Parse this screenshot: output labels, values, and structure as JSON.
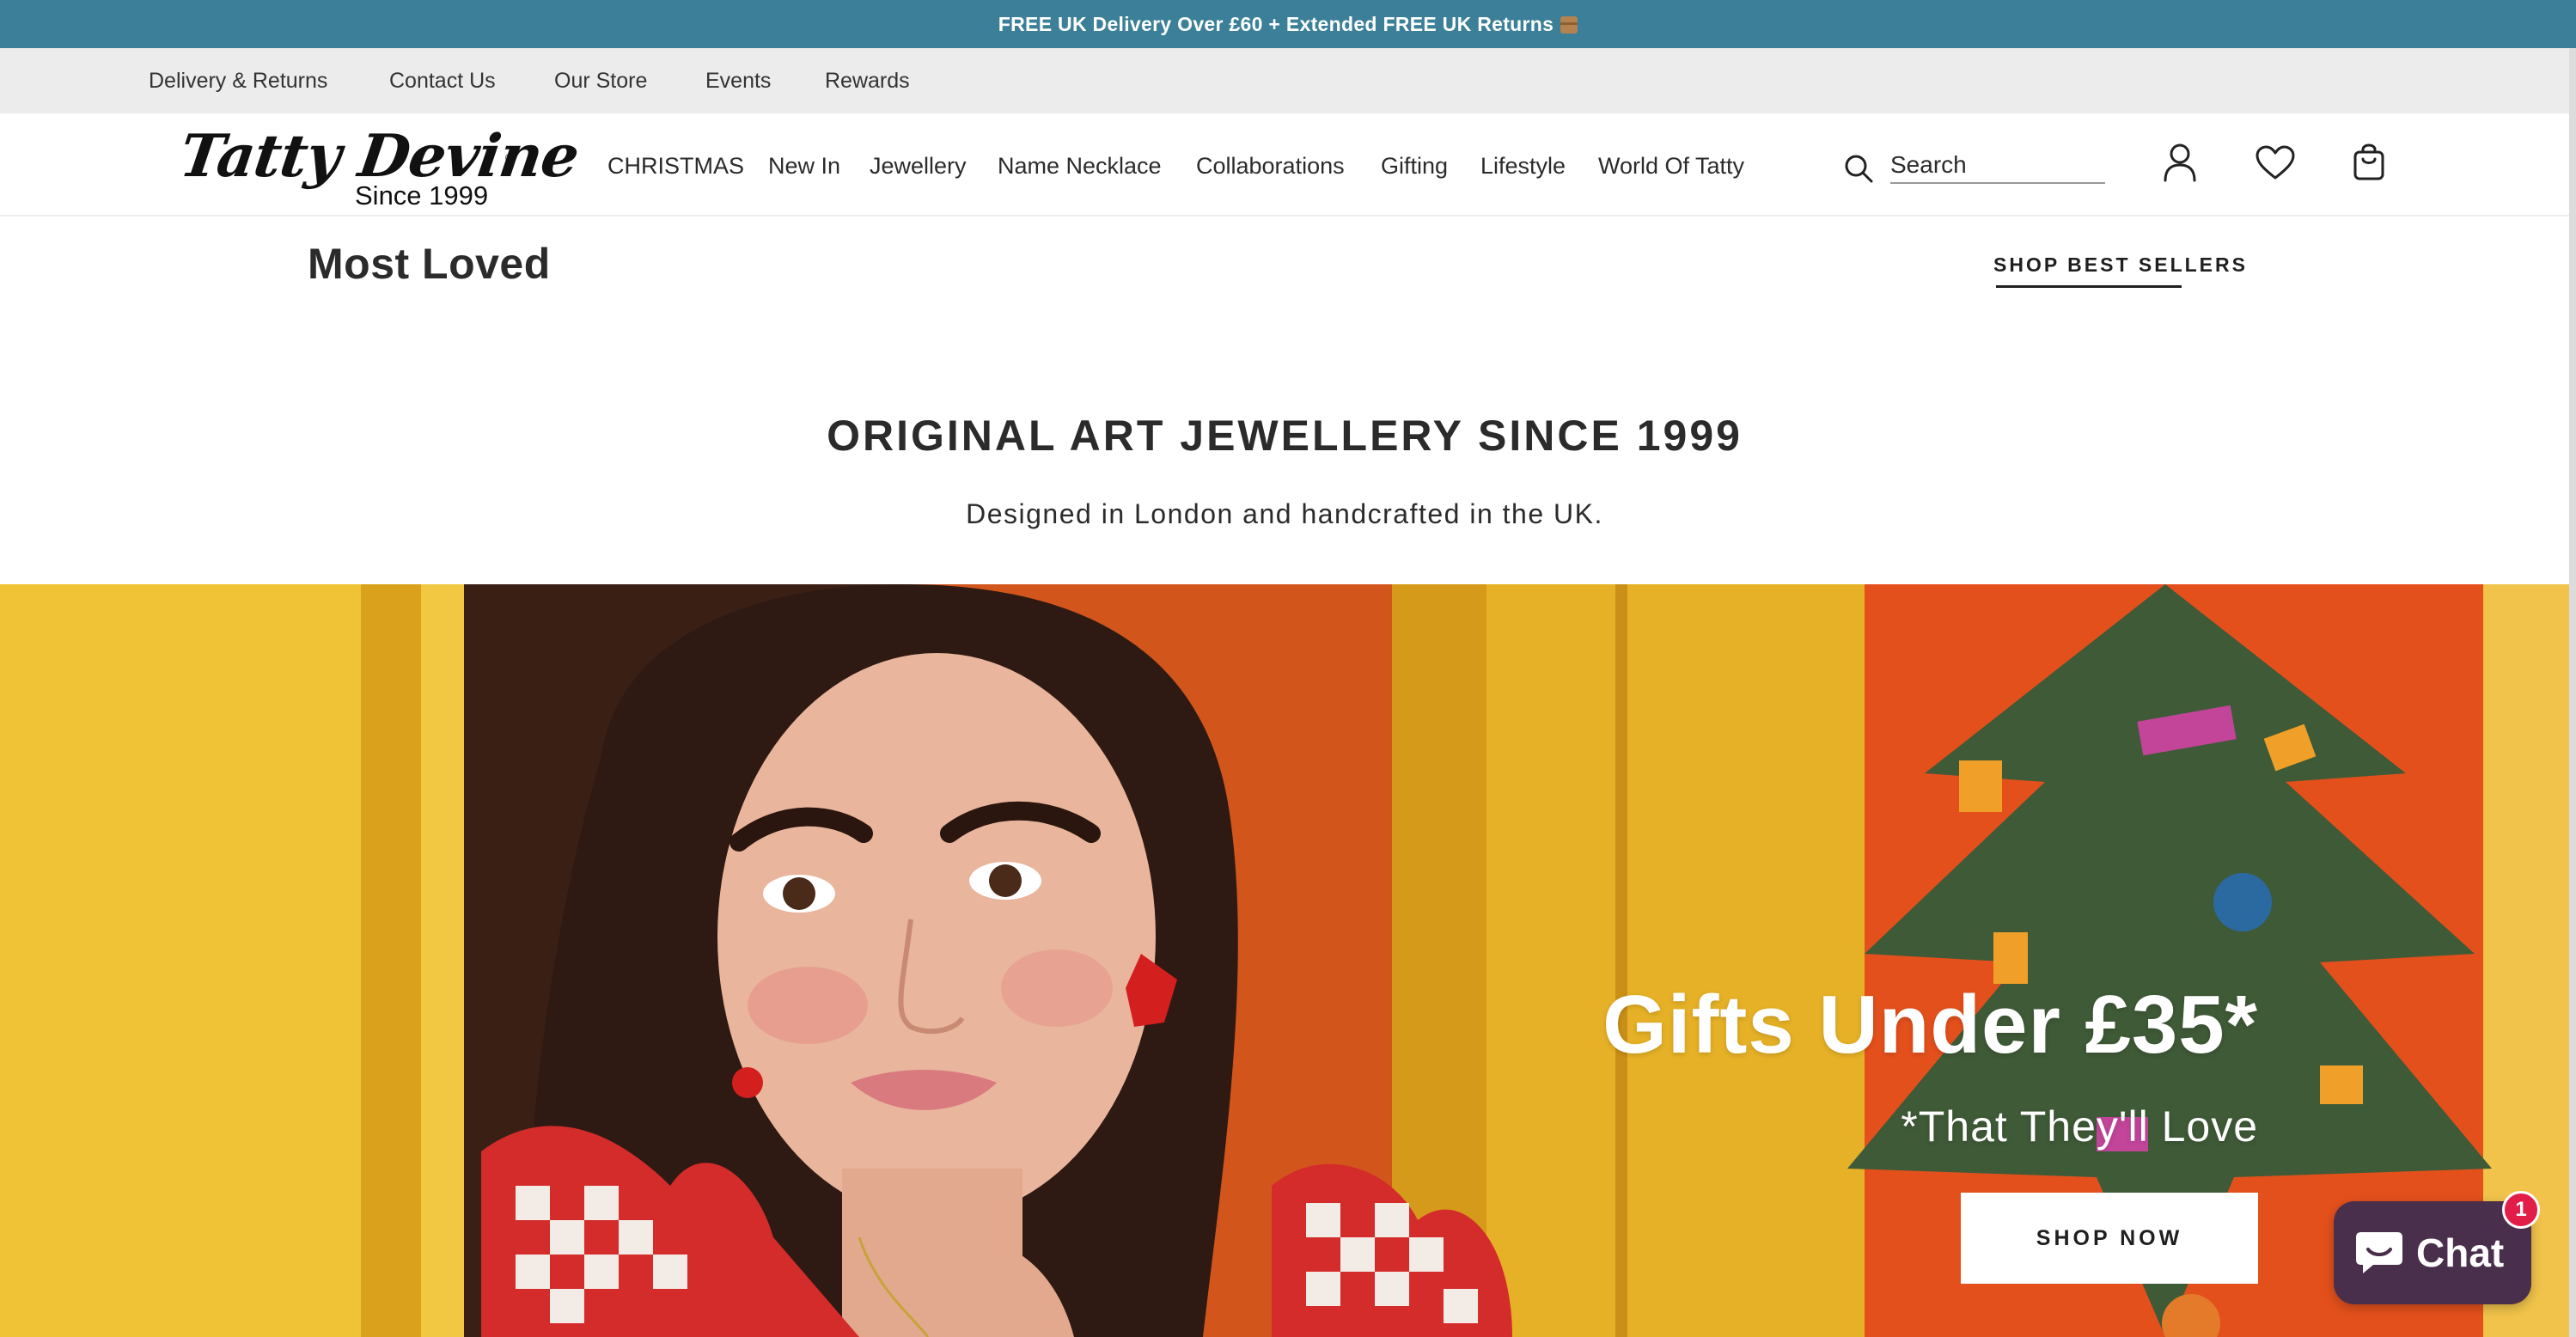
{
  "announcement": {
    "text": "FREE UK Delivery Over £60 + Extended FREE UK Returns",
    "icon": "package-icon"
  },
  "utility_nav": {
    "items": [
      {
        "label": "Delivery & Returns"
      },
      {
        "label": "Contact Us"
      },
      {
        "label": "Our Store"
      },
      {
        "label": "Events"
      },
      {
        "label": "Rewards"
      }
    ]
  },
  "header": {
    "logo": {
      "script": "Tatty Devine",
      "since": "Since 1999",
      "reg": "®"
    },
    "nav": [
      {
        "label": "CHRISTMAS"
      },
      {
        "label": "New In"
      },
      {
        "label": "Jewellery"
      },
      {
        "label": "Name Necklace"
      },
      {
        "label": "Collaborations"
      },
      {
        "label": "Gifting"
      },
      {
        "label": "Lifestyle"
      },
      {
        "label": "World Of Tatty"
      }
    ],
    "search": {
      "placeholder": "Search",
      "value": ""
    },
    "icons": [
      "account-icon",
      "wishlist-heart-icon",
      "shopping-bag-icon"
    ]
  },
  "most_loved": {
    "title": "Most Loved",
    "link": "SHOP BEST SELLERS"
  },
  "intro": {
    "heading": "ORIGINAL ART JEWELLERY SINCE 1999",
    "subheading": "Designed in London and handcrafted in the UK."
  },
  "hero": {
    "title": "Gifts Under £35*",
    "subtitle": "*That They'll Love",
    "button": "SHOP NOW"
  },
  "chat": {
    "label": "Chat",
    "badge": "1"
  },
  "colors": {
    "announcement_bg": "#3b8098",
    "utility_bg": "#ececec",
    "hero_yellow": "#e8b526",
    "hero_orange": "#e3501c",
    "chat_bg": "#4a2f4c",
    "badge_red": "#e11d48"
  }
}
